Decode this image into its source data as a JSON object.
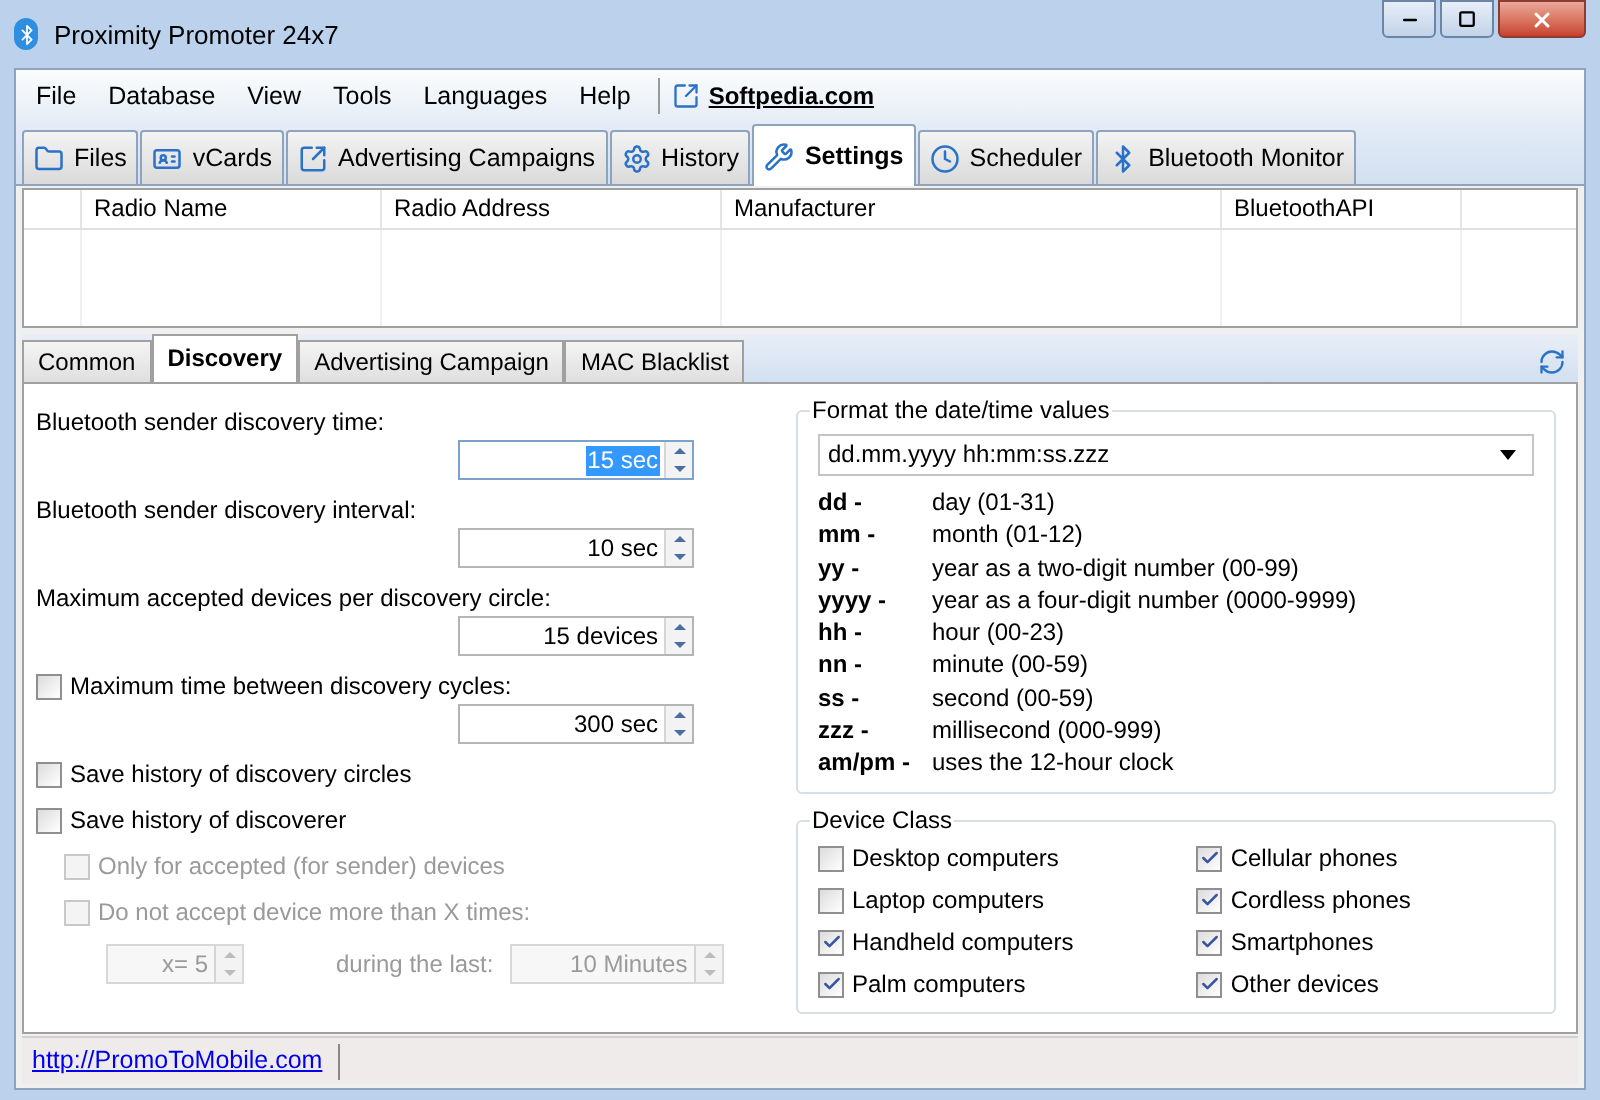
{
  "window": {
    "title": "Proximity Promoter 24x7"
  },
  "menu": [
    "File",
    "Database",
    "View",
    "Tools",
    "Languages",
    "Help"
  ],
  "menu_link": "Softpedia.com",
  "main_tabs": [
    {
      "label": "Files",
      "selected": false
    },
    {
      "label": "vCards",
      "selected": false
    },
    {
      "label": "Advertising Campaigns",
      "selected": false
    },
    {
      "label": "History",
      "selected": false
    },
    {
      "label": "Settings",
      "selected": true
    },
    {
      "label": "Scheduler",
      "selected": false
    },
    {
      "label": "Bluetooth Monitor",
      "selected": false
    }
  ],
  "table": {
    "columns": [
      "Radio Name",
      "Radio Address",
      "Manufacturer",
      "BluetoothAPI"
    ]
  },
  "sub_tabs": [
    {
      "label": "Common",
      "selected": false
    },
    {
      "label": "Discovery",
      "selected": true
    },
    {
      "label": "Advertising Campaign",
      "selected": false
    },
    {
      "label": "MAC Blacklist",
      "selected": false
    }
  ],
  "discovery": {
    "rows": [
      {
        "kind": "spin",
        "label": "Bluetooth sender discovery time:",
        "value": "15 sec",
        "focused": true
      },
      {
        "kind": "spin",
        "label": "Bluetooth sender discovery interval:",
        "value": "10 sec",
        "focused": false
      },
      {
        "kind": "spin",
        "label": "Maximum accepted devices per discovery circle:",
        "value": "15 devices",
        "focused": false
      },
      {
        "kind": "check_spin",
        "label": "Maximum time between discovery cycles:",
        "checked": false,
        "value": "300 sec",
        "focused": false
      },
      {
        "kind": "checkbox",
        "label": "Save history of discovery circles",
        "checked": false,
        "disabled": false
      },
      {
        "kind": "checkbox",
        "label": "Save history of discoverer",
        "checked": false,
        "disabled": false,
        "children": [
          {
            "label": "Only for accepted (for sender) devices",
            "checked": false,
            "disabled": true
          },
          {
            "label": "Do not accept device more than X times:",
            "checked": false,
            "disabled": true
          }
        ]
      }
    ],
    "limit": {
      "count": "x= 5",
      "during_label": "during the last:",
      "period": "10 Minutes",
      "disabled": true
    }
  },
  "format": {
    "title": "Format the date/time values",
    "value": "dd.mm.yyyy hh:mm:ss.zzz",
    "legend": [
      {
        "code": "dd -",
        "meaning": "day (01-31)"
      },
      {
        "code": "mm -",
        "meaning": "month (01-12)"
      },
      {
        "code": "yy -",
        "meaning": "year as a two-digit number (00-99)"
      },
      {
        "code": "yyyy -",
        "meaning": "year as a four-digit number (0000-9999)"
      },
      {
        "code": "hh -",
        "meaning": "hour (00-23)"
      },
      {
        "code": "nn -",
        "meaning": "minute (00-59)"
      },
      {
        "code": "ss -",
        "meaning": "second (00-59)"
      },
      {
        "code": "zzz -",
        "meaning": "millisecond (000-999)"
      },
      {
        "code": "am/pm -",
        "meaning": "uses the 12-hour clock"
      }
    ]
  },
  "device_class": {
    "title": "Device Class",
    "items": [
      {
        "label": "Desktop computers",
        "checked": false
      },
      {
        "label": "Laptop computers",
        "checked": false
      },
      {
        "label": "Handheld computers",
        "checked": true
      },
      {
        "label": "Palm computers",
        "checked": true
      },
      {
        "label": "Cellular phones",
        "checked": true
      },
      {
        "label": "Cordless phones",
        "checked": true
      },
      {
        "label": "Smartphones",
        "checked": true
      },
      {
        "label": "Other devices",
        "checked": true
      }
    ]
  },
  "status_bar": {
    "link": "http://PromoToMobile.com"
  }
}
